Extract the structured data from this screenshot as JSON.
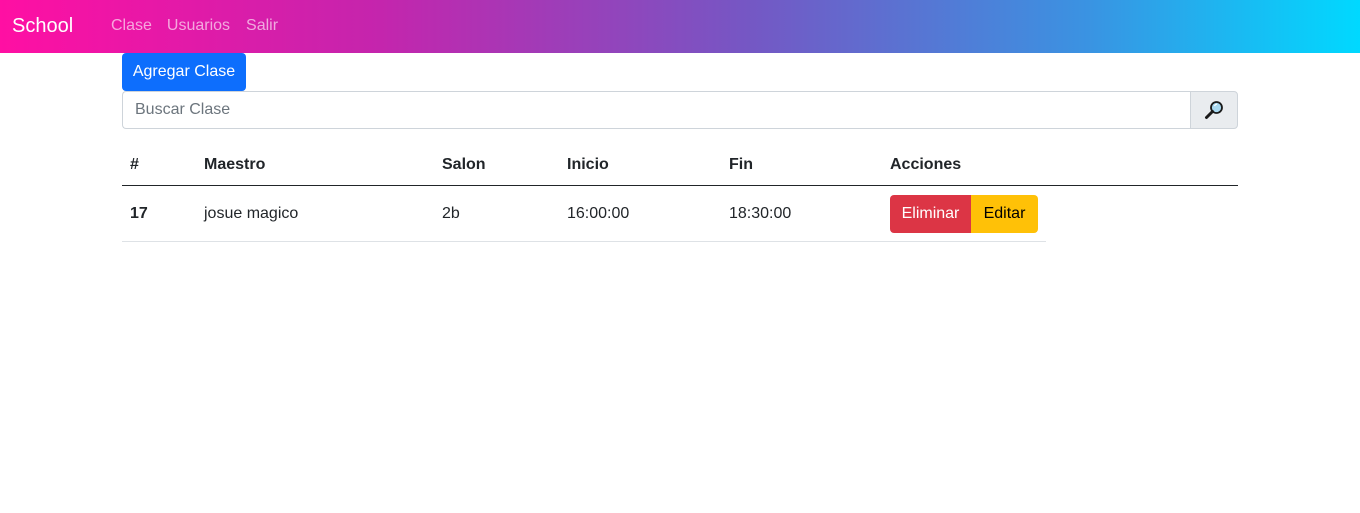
{
  "navbar": {
    "brand": "School",
    "links": [
      "Clase",
      "Usuarios",
      "Salir"
    ]
  },
  "toolbar": {
    "add_label": "Agregar Clase"
  },
  "search": {
    "placeholder": "Buscar Clase",
    "value": "",
    "icon": "search-icon"
  },
  "table": {
    "headers": [
      "#",
      "Maestro",
      "Salon",
      "Inicio",
      "Fin",
      "Acciones"
    ],
    "rows": [
      {
        "id": "17",
        "maestro": "josue magico",
        "salon": "2b",
        "inicio": "16:00:00",
        "fin": "18:30:00",
        "delete_label": "Eliminar",
        "edit_label": "Editar"
      }
    ]
  },
  "colors": {
    "gradient_start": "#ff0fa3",
    "gradient_end": "#00d9ff",
    "primary": "#0d6efd",
    "danger": "#dc3545",
    "warning": "#ffc107"
  }
}
